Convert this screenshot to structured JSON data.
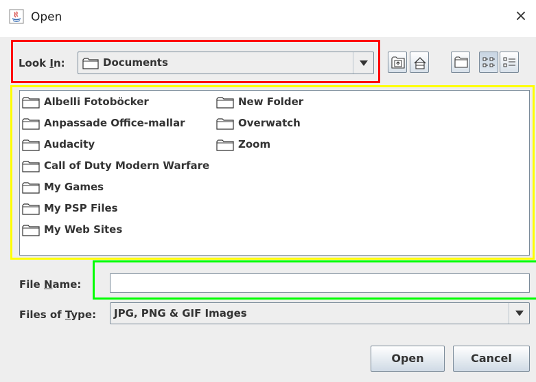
{
  "window": {
    "title": "Open",
    "close_symbol": "×"
  },
  "look_in": {
    "label_pre": "Look ",
    "label_mnemonic": "I",
    "label_post": "n:",
    "value": "Documents"
  },
  "toolbar": {
    "buttons": [
      {
        "name": "up-one-level-button",
        "icon": "up-folder-icon"
      },
      {
        "name": "home-button",
        "icon": "home-icon"
      },
      {
        "name": "new-folder-button",
        "icon": "new-folder-icon"
      },
      {
        "name": "list-view-button",
        "icon": "list-icon",
        "pressed": true
      },
      {
        "name": "details-view-button",
        "icon": "details-icon"
      }
    ]
  },
  "files": {
    "column1": [
      "Albelli Fotoböcker",
      "Anpassade Office-mallar",
      "Audacity",
      "Call of Duty Modern Warfare",
      "My Games",
      "My PSP Files",
      "My Web Sites"
    ],
    "column2": [
      "New Folder",
      "Overwatch",
      "Zoom"
    ]
  },
  "file_name": {
    "label_pre": "File ",
    "label_mnemonic": "N",
    "label_post": "ame:",
    "value": ""
  },
  "file_type": {
    "label_pre": "Files of ",
    "label_mnemonic": "T",
    "label_post": "ype:",
    "value": "JPG, PNG & GIF Images"
  },
  "actions": {
    "open_label": "Open",
    "cancel_label": "Cancel"
  },
  "highlights": {
    "red": "#ff0000",
    "yellow": "#ffff00",
    "green": "#00ff00"
  }
}
